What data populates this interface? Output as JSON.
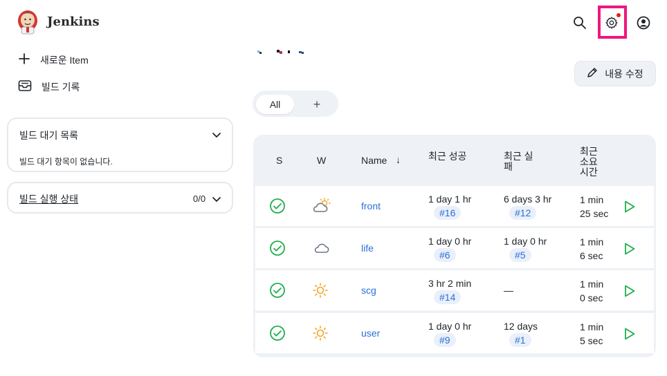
{
  "header": {
    "brand": "Jenkins",
    "icons": [
      "search-icon",
      "gear-icon",
      "user-icon"
    ],
    "highlight_color": "#f0157f",
    "notification_color": "#e5231b"
  },
  "sidebar": {
    "tasks": [
      {
        "label": "새로운 Item",
        "icon": "plus-icon"
      },
      {
        "label": "빌드 기록",
        "icon": "inbox-icon"
      }
    ],
    "queue": {
      "title": "빌드 대기 목록",
      "empty_text": "빌드 대기 항목이 없습니다."
    },
    "executors": {
      "title": "빌드 실행 상태",
      "count": "0/0"
    }
  },
  "main": {
    "edit_button": "내용 수정",
    "tabs": [
      {
        "label": "All"
      },
      {
        "label": "+"
      }
    ],
    "table": {
      "headers": {
        "s": "S",
        "w": "W",
        "name": "Name",
        "sort_arrow": "↓",
        "last_success": "최근 성공",
        "last_failure": "최근 실패",
        "last_duration": "최근 소요 시간"
      },
      "rows": [
        {
          "status": "success",
          "weather": "partly-cloudy",
          "name": "front",
          "success_time": "1 day 1 hr",
          "success_build": "#16",
          "failure_time": "6 days 3 hr",
          "failure_build": "#12",
          "duration_line1": "1 min",
          "duration_line2": "25 sec"
        },
        {
          "status": "success",
          "weather": "cloudy",
          "name": "life",
          "success_time": "1 day 0 hr",
          "success_build": "#6",
          "failure_time": "1 day 0 hr",
          "failure_build": "#5",
          "duration_line1": "1 min",
          "duration_line2": "6 sec"
        },
        {
          "status": "success",
          "weather": "sunny",
          "name": "scg",
          "success_time": "3 hr 2 min",
          "success_build": "#14",
          "failure_time": "—",
          "failure_build": "",
          "duration_line1": "1 min",
          "duration_line2": "0 sec"
        },
        {
          "status": "success",
          "weather": "sunny",
          "name": "user",
          "success_time": "1 day 0 hr",
          "success_build": "#9",
          "failure_time": "12 days",
          "failure_build": "#1",
          "duration_line1": "1 min",
          "duration_line2": "5 sec"
        }
      ]
    }
  },
  "colors": {
    "success": "#1fae4b",
    "link": "#2b6fd6",
    "sun": "#f5a623",
    "cloud": "#6b7785"
  }
}
